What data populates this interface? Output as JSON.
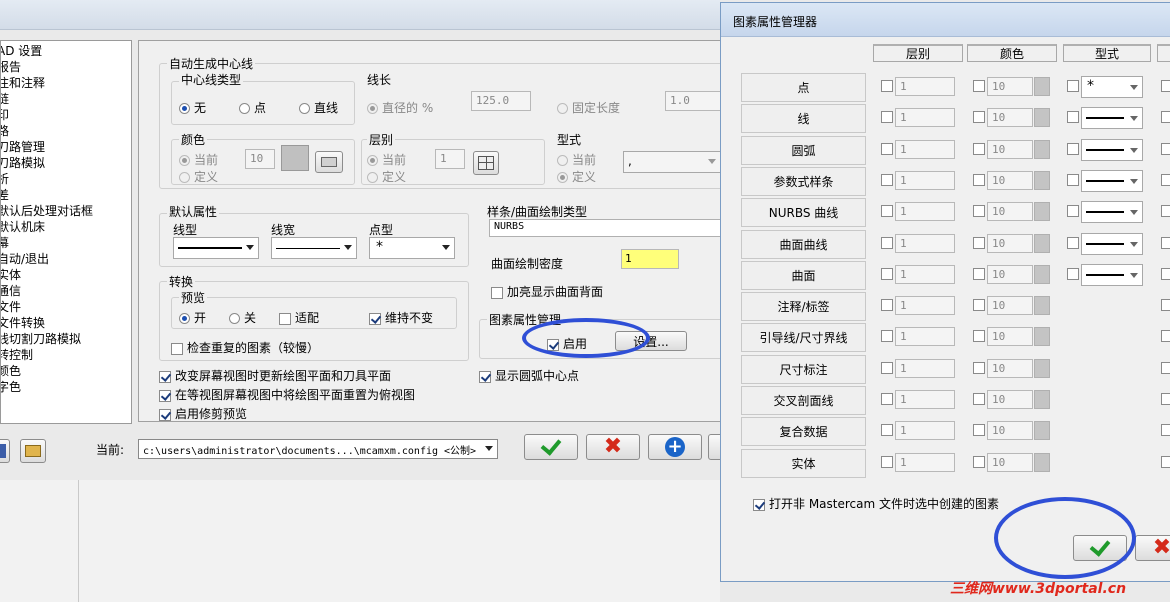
{
  "sidebar": {
    "items": [
      "AD 设置",
      "报告",
      "注和注释",
      "链",
      "印",
      "路",
      "刀路管理",
      "刀路模拟",
      "析",
      "差",
      "默认后处理对话框",
      "默认机床",
      "幕",
      "自动/退出",
      "实体",
      "通信",
      "文件",
      "文件转换",
      "线切割刀路模拟",
      "转控制",
      "颜色",
      "字色"
    ]
  },
  "centerline": {
    "group_title": "自动生成中心线",
    "type_title": "中心线类型",
    "type_options": [
      "无",
      "点",
      "直线"
    ],
    "length_title": "线长",
    "diameter_pct_label": "直径的 %",
    "diameter_pct_value": "125.0",
    "fixed_length_label": "固定长度",
    "fixed_length_value": "1.0",
    "color_title": "颜色",
    "current_label": "当前",
    "define_label": "定义",
    "color_value": "10",
    "level_title": "层别",
    "level_value": "1",
    "style_title": "型式",
    "style_value": ","
  },
  "defaults": {
    "title": "默认属性",
    "linetype_label": "线型",
    "linewidth_label": "线宽",
    "pointtype_label": "点型",
    "pointtype_value": "*"
  },
  "spline": {
    "title": "样条/曲面绘制类型",
    "type_value": "NURBS",
    "density_label": "曲面绘制密度",
    "density_value": "1",
    "highlight_back_label": "加亮显示曲面背面"
  },
  "convert": {
    "title": "转换",
    "preview_title": "预览",
    "on_label": "开",
    "off_label": "关",
    "fit_label": "适配",
    "keep_label": "维持不变",
    "check_dup_label": "检查重复的图素（较慢）"
  },
  "entity_attr": {
    "title": "图素属性管理",
    "enable_label": "启用",
    "settings_label": "设置..."
  },
  "options": [
    "改变屏幕视图时更新绘图平面和刀具平面",
    "在等视图屏幕视图中将绘图平面重置为俯视图",
    "启用修剪预览"
  ],
  "arc_center_label": "显示圆弧中心点",
  "bottom": {
    "current_label": "当前:",
    "config_path": "c:\\users\\administrator\\documents...\\mcamxm.config <公制>"
  },
  "dialog": {
    "title": "图素属性管理器",
    "headers": [
      "层别",
      "颜色",
      "型式"
    ],
    "rows": [
      {
        "label": "点",
        "level": "1",
        "color": "10",
        "style": "*"
      },
      {
        "label": "线",
        "level": "1",
        "color": "10",
        "style": "line"
      },
      {
        "label": "圆弧",
        "level": "1",
        "color": "10",
        "style": "line"
      },
      {
        "label": "参数式样条",
        "level": "1",
        "color": "10",
        "style": "line"
      },
      {
        "label": "NURBS 曲线",
        "level": "1",
        "color": "10",
        "style": "line"
      },
      {
        "label": "曲面曲线",
        "level": "1",
        "color": "10",
        "style": "line"
      },
      {
        "label": "曲面",
        "level": "1",
        "color": "10",
        "style": "line"
      },
      {
        "label": "注释/标签",
        "level": "1",
        "color": "10",
        "style": ""
      },
      {
        "label": "引导线/尺寸界线",
        "level": "1",
        "color": "10",
        "style": ""
      },
      {
        "label": "尺寸标注",
        "level": "1",
        "color": "10",
        "style": ""
      },
      {
        "label": "交叉剖面线",
        "level": "1",
        "color": "10",
        "style": ""
      },
      {
        "label": "复合数据",
        "level": "1",
        "color": "10",
        "style": ""
      },
      {
        "label": "实体",
        "level": "1",
        "color": "10",
        "style": ""
      }
    ],
    "nonmc_label": "打开非 Mastercam 文件时选中创建的图素"
  },
  "watermark": "三维网www.3dportal.cn",
  "colors": {
    "ok_green": "#1f9a2b",
    "cancel_red": "#d42a1a",
    "add_blue": "#1a64c8",
    "highlight_yellow": "#ffff7a",
    "annotation_circle": "#2f4fd6",
    "watermark_red": "#e0281c"
  }
}
